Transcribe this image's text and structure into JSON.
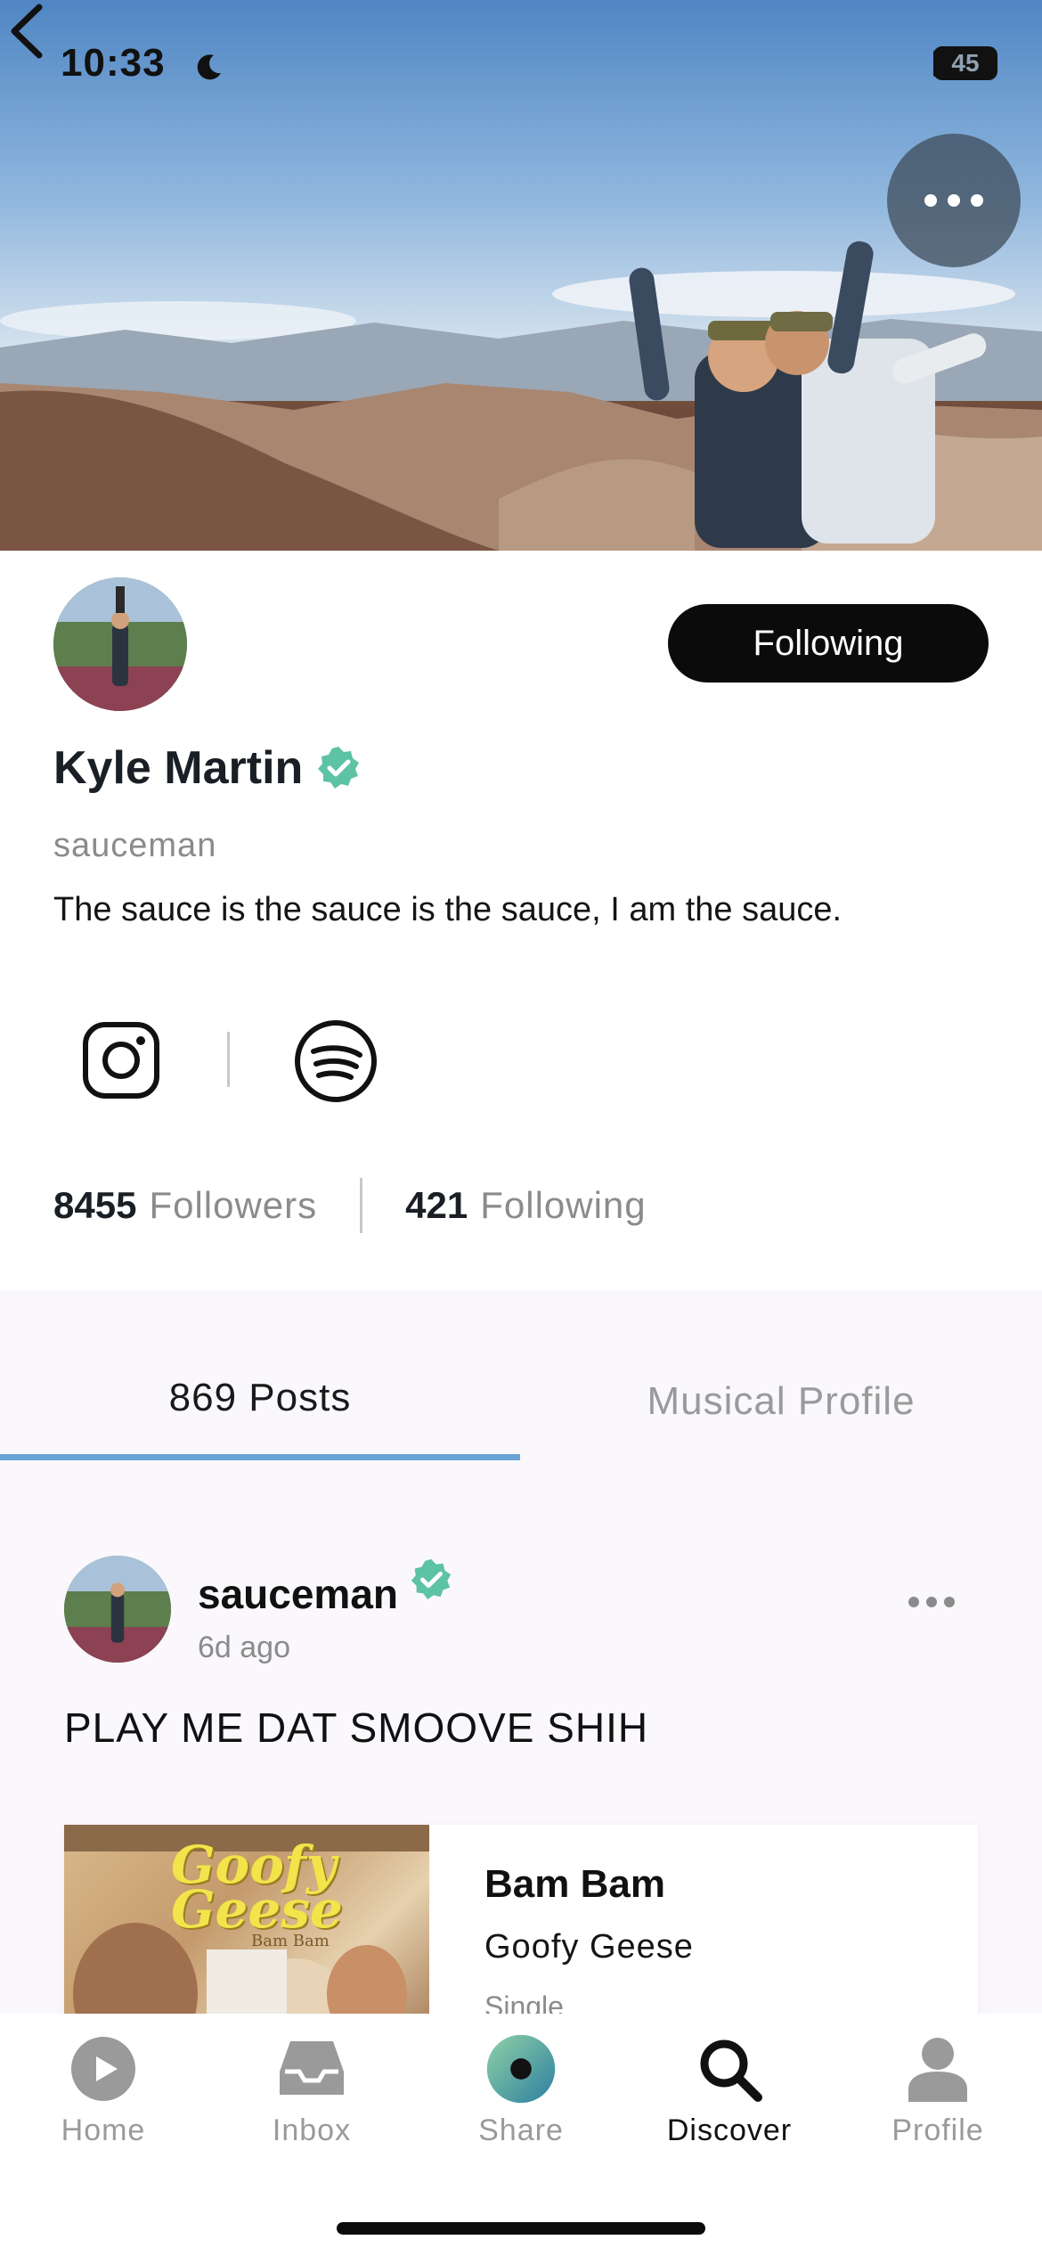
{
  "status_bar": {
    "time": "10:33",
    "battery": "45"
  },
  "profile": {
    "name": "Kyle Martin",
    "handle": "sauceman",
    "bio": "The sauce is the sauce is the sauce, I am the sauce.",
    "follow_button": "Following",
    "followers_count": "8455",
    "followers_label": "Followers",
    "following_count": "421",
    "following_label": "Following"
  },
  "tabs": [
    {
      "label": "869 Posts",
      "active": true
    },
    {
      "label": "Musical Profile",
      "active": false
    }
  ],
  "post": {
    "user": "sauceman",
    "time": "6d ago",
    "text": "PLAY ME DAT SMOOVE SHIH",
    "track": {
      "title": "Bam Bam",
      "artist": "Goofy Geese",
      "type": "Single",
      "album_art_text": "Goofy Geese",
      "album_art_subtext": "Bam Bam"
    }
  },
  "nav": [
    {
      "label": "Home",
      "icon": "play-circle-icon",
      "active": false
    },
    {
      "label": "Inbox",
      "icon": "inbox-tray-icon",
      "active": false
    },
    {
      "label": "Share",
      "icon": "share-orb-icon",
      "active": false
    },
    {
      "label": "Discover",
      "icon": "search-icon",
      "active": true
    },
    {
      "label": "Profile",
      "icon": "person-icon",
      "active": false
    }
  ],
  "colors": {
    "accent_tab": "#6aa3d5",
    "verified": "#5cc3a4",
    "button_bg": "#0b0b0b"
  }
}
